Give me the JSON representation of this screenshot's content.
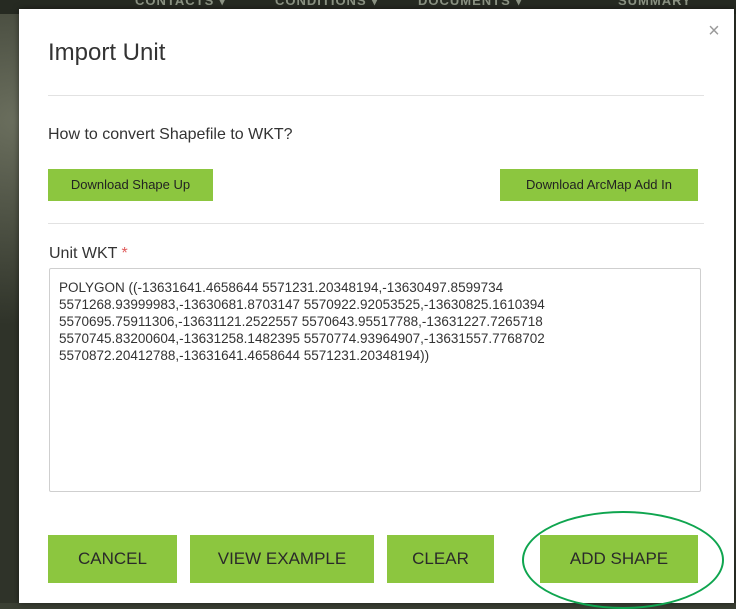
{
  "background_nav": [
    "CONTACTS ▾",
    "CONDITIONS ▾",
    "DOCUMENTS ▾",
    "SUMMARY"
  ],
  "dialog": {
    "title": "Import Unit",
    "close_symbol": "×",
    "question": "How to convert Shapefile to WKT?",
    "download_shape_up_label": "Download Shape Up",
    "download_arcmap_label": "Download ArcMap Add In",
    "field_label": "Unit WKT",
    "required_marker": "*",
    "wkt_value": "POLYGON ((-13631641.4658644 5571231.20348194,-13630497.8599734\n5571268.93999983,-13630681.8703147 5570922.92053525,-13630825.1610394\n5570695.75911306,-13631121.2522557 5570643.95517788,-13631227.7265718\n5570745.83200604,-13631258.1482395 5570774.93964907,-13631557.7768702\n5570872.20412788,-13631641.4658644 5571231.20348194))",
    "buttons": {
      "cancel": "CANCEL",
      "view_example": "VIEW EXAMPLE",
      "clear": "CLEAR",
      "add_shape": "ADD SHAPE"
    }
  },
  "colors": {
    "accent": "#8cc63f",
    "highlight_ring": "#0fa54f",
    "required": "#e05a5a"
  }
}
